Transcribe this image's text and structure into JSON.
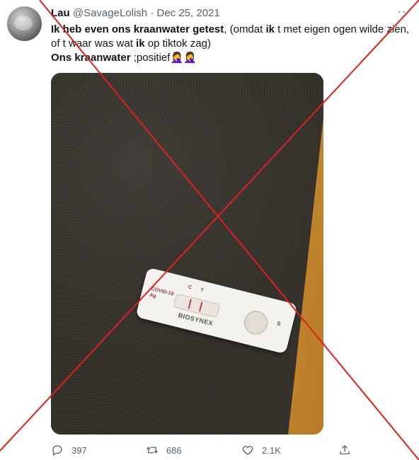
{
  "tweet": {
    "author_name": "Lau",
    "handle": "@SavageLolish",
    "separator": "·",
    "date": "Dec 25, 2021",
    "line1_bold": "Ik heb even ons kraanwater getest",
    "line1_rest_a": ", (omdat ",
    "line1_bold2": "ik",
    "line1_rest_b": " t met eigen ogen wilde zien, of t waar was wat ",
    "line1_bold3": "ik",
    "line1_rest_c": " op tiktok zag)",
    "line2_bold": "Ons kraanwater",
    "line2_rest": " ;positief",
    "emoji": "🤦‍♀️🤦‍♀️",
    "more_label": "···"
  },
  "photo": {
    "test_label": "COVID-19 Ag",
    "c_label": "C",
    "t_label": "T",
    "s_label": "S",
    "brand": "BIOSYNEX"
  },
  "actions": {
    "replies": "397",
    "retweets": "686",
    "likes": "2.1K"
  },
  "colors": {
    "cross": "#e0201b",
    "muted": "#536471"
  }
}
